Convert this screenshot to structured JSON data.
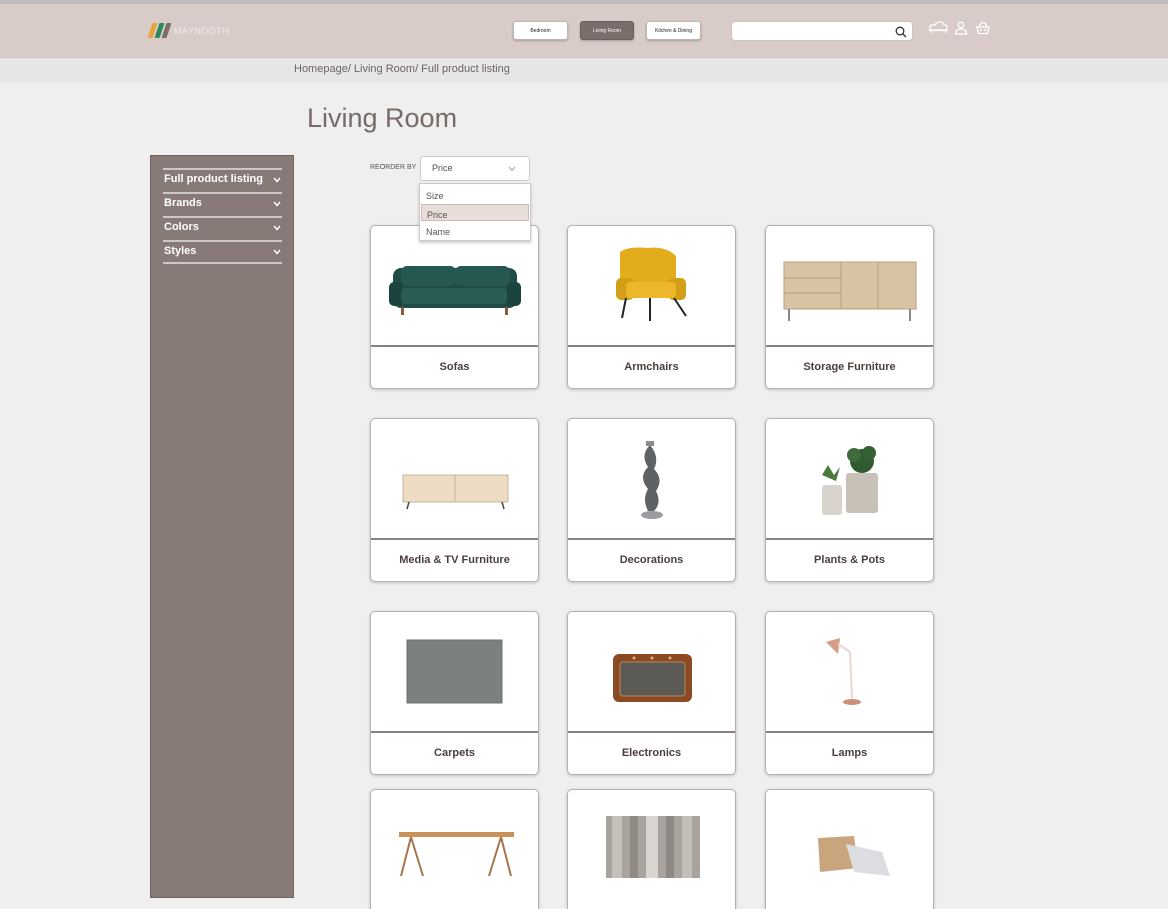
{
  "header": {
    "logo_text": "MAYNOOTH",
    "nav": [
      "Bedroom",
      "Living Room",
      "Kitchen & Dining"
    ],
    "active_nav": "Living Room",
    "search_placeholder": "",
    "icons": [
      "search-icon",
      "sofa-icon",
      "user-icon",
      "basket-icon"
    ]
  },
  "breadcrumb": "Homepage/ Living Room/ Full product listing",
  "page_title": "Living Room",
  "sidebar": {
    "filters": [
      "Full product listing",
      "Brands",
      "Colors",
      "Styles"
    ]
  },
  "sort": {
    "label": "REORDER BY",
    "selected": "Price",
    "options": [
      "Size",
      "Price",
      "Name"
    ]
  },
  "categories": [
    {
      "label": "Sofas",
      "image": "green-sofa"
    },
    {
      "label": "Armchairs",
      "image": "yellow-armchair"
    },
    {
      "label": "Storage Furniture",
      "image": "wooden-sideboard"
    },
    {
      "label": "Media & TV Furniture",
      "image": "tv-stand"
    },
    {
      "label": "Decorations",
      "image": "sculpture"
    },
    {
      "label": "Plants & Pots",
      "image": "potted-plants"
    },
    {
      "label": "Carpets",
      "image": "grey-carpet"
    },
    {
      "label": "Electronics",
      "image": "retro-speaker"
    },
    {
      "label": "Lamps",
      "image": "desk-lamp"
    },
    {
      "label": "",
      "image": "wooden-table"
    },
    {
      "label": "",
      "image": "curtains"
    },
    {
      "label": "",
      "image": "cushions"
    }
  ],
  "colors": {
    "header_bg": "#d9ccc8",
    "sidebar_bg": "#877a77",
    "active_nav_bg": "#7a6d6a",
    "page_bg": "#efefef"
  }
}
